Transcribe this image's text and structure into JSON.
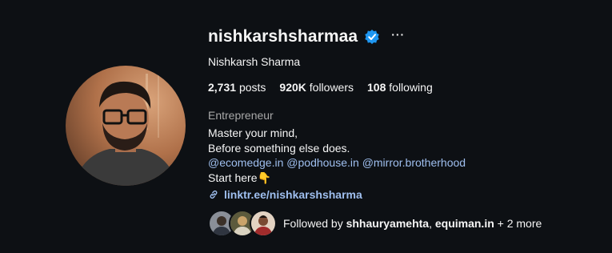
{
  "profile": {
    "username": "nishkarshsharmaa",
    "full_name": "Nishkarsh Sharma",
    "verified_icon": "verified-badge-icon",
    "more_label": "···"
  },
  "stats": {
    "posts_count": "2,731",
    "posts_label": "posts",
    "followers_count": "920K",
    "followers_label": "followers",
    "following_count": "108",
    "following_label": "following"
  },
  "bio": {
    "category": "Entrepreneur",
    "line1": "Master your mind,",
    "line2": "Before something else does.",
    "mentions": [
      "@ecomedge.in",
      "@podhouse.in",
      "@mirror.brotherhood"
    ],
    "line4": "Start here👇",
    "link": "linktr.ee/nishkarshsharma"
  },
  "followed_by": {
    "prefix": "Followed by",
    "user1": "shhauryamehta",
    "separator": ",",
    "user2": "equiman.in",
    "suffix": "+ 2 more"
  },
  "colors": {
    "background": "#0d1014",
    "text": "#f5f5f5",
    "secondary": "#a8a8a8",
    "link": "#9fbfef",
    "verified": "#1e96f0"
  }
}
